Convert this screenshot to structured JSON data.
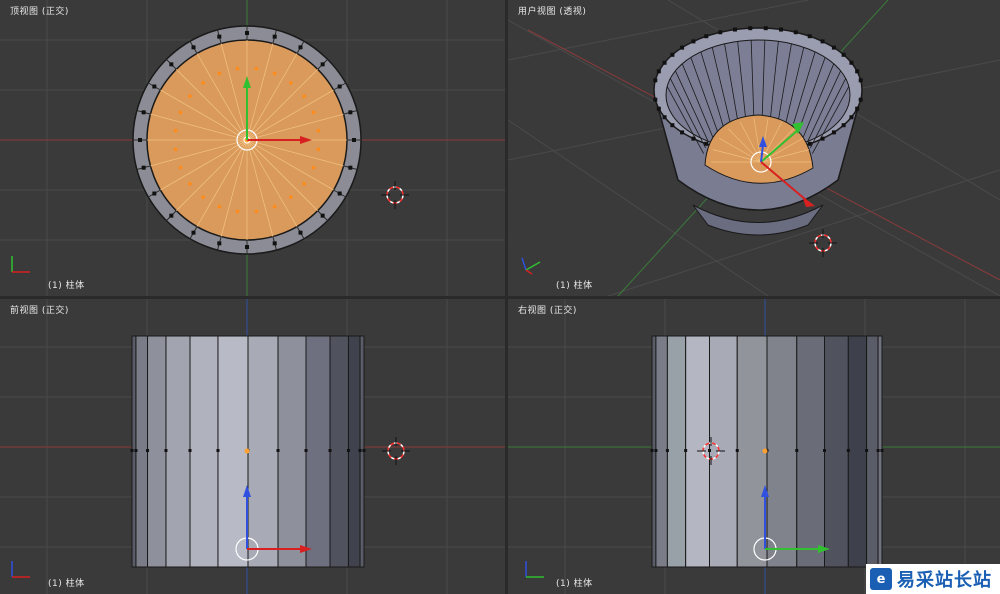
{
  "viewports": {
    "top": {
      "title": "顶视图 (正交)",
      "object": "(1) 柱体"
    },
    "user": {
      "title": "用户视图 (透视)",
      "object": "(1) 柱体"
    },
    "front": {
      "title": "前视图 (正交)",
      "object": "(1) 柱体"
    },
    "right": {
      "title": "右视图 (正交)",
      "object": "(1) 柱体"
    }
  },
  "watermark": {
    "text": "易采站长站",
    "logo": "e-icon"
  },
  "colors": {
    "background": "#3a3a3a",
    "selected_face": "#d99a5c",
    "wire": "#1a1a1a",
    "axis_x": "#c83030",
    "axis_y": "#3aa03a",
    "axis_z": "#3050c8",
    "cursor": "#ff3030"
  }
}
